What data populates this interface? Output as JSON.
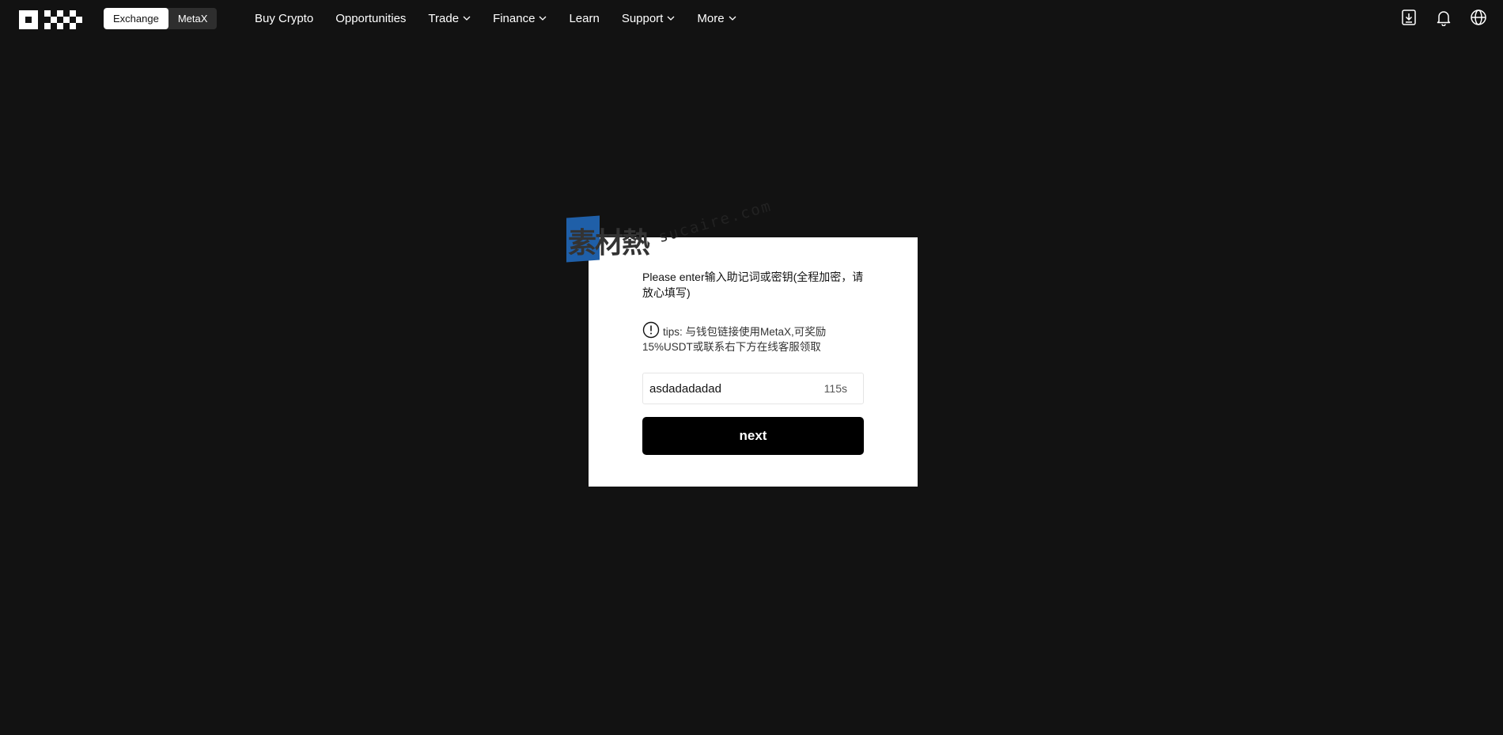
{
  "header": {
    "logo_icon": "okx-logo-icon",
    "switcher": {
      "exchange_label": "Exchange",
      "metax_label": "MetaX",
      "active": "Exchange"
    },
    "nav": [
      {
        "label": "Buy Crypto",
        "dropdown": false
      },
      {
        "label": "Opportunities",
        "dropdown": false
      },
      {
        "label": "Trade",
        "dropdown": true
      },
      {
        "label": "Finance",
        "dropdown": true
      },
      {
        "label": "Learn",
        "dropdown": false
      },
      {
        "label": "Support",
        "dropdown": true
      },
      {
        "label": "More",
        "dropdown": true
      }
    ],
    "right_icons": [
      "download-icon",
      "bell-icon",
      "globe-icon"
    ]
  },
  "watermark": {
    "chars": "素材熱",
    "url": "sucaire.com"
  },
  "modal": {
    "instructions": "Please enter输入助记词或密钥(全程加密，请放心填写)",
    "tip_icon": "info-icon",
    "tip_text": "tips: 与钱包链接使用MetaX,可奖励15%USDT或联系右下方在线客服领取",
    "input_value": "asdadadadad",
    "countdown": "115s",
    "next_label": "next"
  },
  "colors": {
    "background": "#121212",
    "modal_bg": "#ffffff",
    "button_bg": "#000000",
    "watermark_blue": "#1f5fa8"
  }
}
